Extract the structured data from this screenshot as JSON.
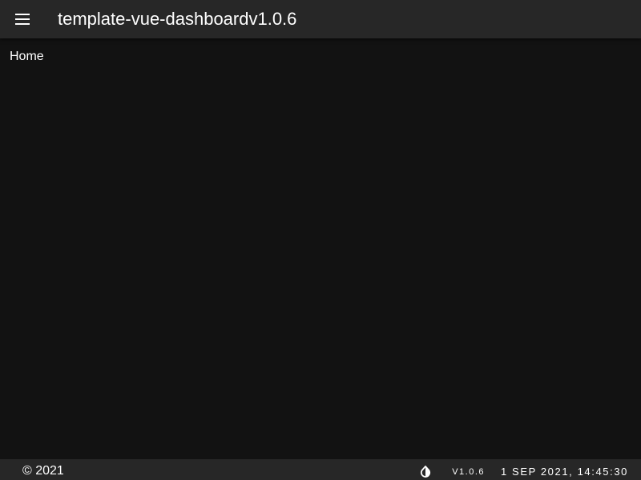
{
  "app_bar": {
    "title": "template-vue-dashboardv1.0.6",
    "menu_icon": "hamburger-menu-icon",
    "background": "#272727"
  },
  "main": {
    "page_label": "Home",
    "background": "#121212"
  },
  "footer": {
    "copyright": "© 2021",
    "theme_icon": "invert-colors-icon",
    "version": "V1.0.6",
    "datetime": "1 SEP 2021, 14:45:30",
    "background": "#272727"
  }
}
